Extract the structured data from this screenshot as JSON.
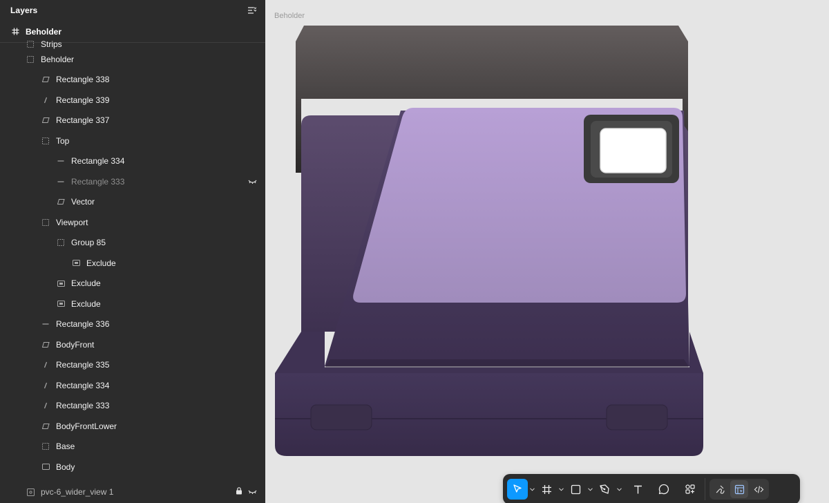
{
  "panel": {
    "title": "Layers",
    "page": {
      "label": "Beholder"
    },
    "partial_label": "Strips",
    "layers": [
      {
        "label": "Beholder",
        "indent": 0,
        "icon": "frame-icon",
        "dim": false,
        "hidden": false
      },
      {
        "label": "Rectangle 338",
        "indent": 1,
        "icon": "vector-icon",
        "dim": false,
        "hidden": false
      },
      {
        "label": "Rectangle 339",
        "indent": 1,
        "icon": "line-icon",
        "dim": false,
        "hidden": false
      },
      {
        "label": "Rectangle 337",
        "indent": 1,
        "icon": "vector-icon",
        "dim": false,
        "hidden": false
      },
      {
        "label": "Top",
        "indent": 1,
        "icon": "frame-icon",
        "dim": false,
        "hidden": false
      },
      {
        "label": "Rectangle 334",
        "indent": 2,
        "icon": "dash-icon",
        "dim": false,
        "hidden": false
      },
      {
        "label": "Rectangle 333",
        "indent": 2,
        "icon": "dash-icon",
        "dim": true,
        "hidden": true
      },
      {
        "label": "Vector",
        "indent": 2,
        "icon": "vector-icon",
        "dim": false,
        "hidden": false
      },
      {
        "label": "Viewport",
        "indent": 1,
        "icon": "frame-icon",
        "dim": false,
        "hidden": false
      },
      {
        "label": "Group 85",
        "indent": 2,
        "icon": "frame-icon",
        "dim": false,
        "hidden": false
      },
      {
        "label": "Exclude",
        "indent": 3,
        "icon": "boolean-icon",
        "dim": false,
        "hidden": false
      },
      {
        "label": "Exclude",
        "indent": 2,
        "icon": "boolean-icon",
        "dim": false,
        "hidden": false
      },
      {
        "label": "Exclude",
        "indent": 2,
        "icon": "boolean-icon",
        "dim": false,
        "hidden": false
      },
      {
        "label": "Rectangle 336",
        "indent": 1,
        "icon": "dash-icon",
        "dim": false,
        "hidden": false
      },
      {
        "label": "BodyFront",
        "indent": 1,
        "icon": "vector-icon",
        "dim": false,
        "hidden": false
      },
      {
        "label": "Rectangle 335",
        "indent": 1,
        "icon": "line-icon",
        "dim": false,
        "hidden": false
      },
      {
        "label": "Rectangle 334",
        "indent": 1,
        "icon": "line-icon",
        "dim": false,
        "hidden": false
      },
      {
        "label": "Rectangle 333",
        "indent": 1,
        "icon": "line-icon",
        "dim": false,
        "hidden": false
      },
      {
        "label": "BodyFrontLower",
        "indent": 1,
        "icon": "vector-icon",
        "dim": false,
        "hidden": false
      },
      {
        "label": "Base",
        "indent": 1,
        "icon": "frame-icon",
        "dim": false,
        "hidden": false
      },
      {
        "label": "Body",
        "indent": 1,
        "icon": "rect-icon",
        "dim": false,
        "hidden": false
      }
    ],
    "bottom_item": {
      "label": "pvc-6_wider_view 1",
      "icon": "image-icon"
    }
  },
  "canvas": {
    "frame_label": "Beholder",
    "background": "#e5e5e5",
    "accent_purple": "#b9a3d6",
    "body_purple": "#3f3253",
    "top_gray": "#5c5757"
  },
  "toolbar": {
    "tools": [
      {
        "name": "move-tool",
        "icon": "pointer-icon",
        "active": true,
        "caret": true
      },
      {
        "name": "frame-tool",
        "icon": "hash-icon",
        "active": false,
        "caret": true
      },
      {
        "name": "shape-tool",
        "icon": "square-icon",
        "active": false,
        "caret": true
      },
      {
        "name": "pen-tool",
        "icon": "pen-icon",
        "active": false,
        "caret": true
      },
      {
        "name": "text-tool",
        "icon": "text-icon",
        "active": false,
        "caret": false
      },
      {
        "name": "comment-tool",
        "icon": "comment-icon",
        "active": false,
        "caret": false
      },
      {
        "name": "resources-tool",
        "icon": "components-icon",
        "active": false,
        "caret": false
      }
    ],
    "modes": [
      "draw-mode-icon",
      "design-mode-icon",
      "dev-mode-icon"
    ],
    "accent": "#0d99ff"
  }
}
